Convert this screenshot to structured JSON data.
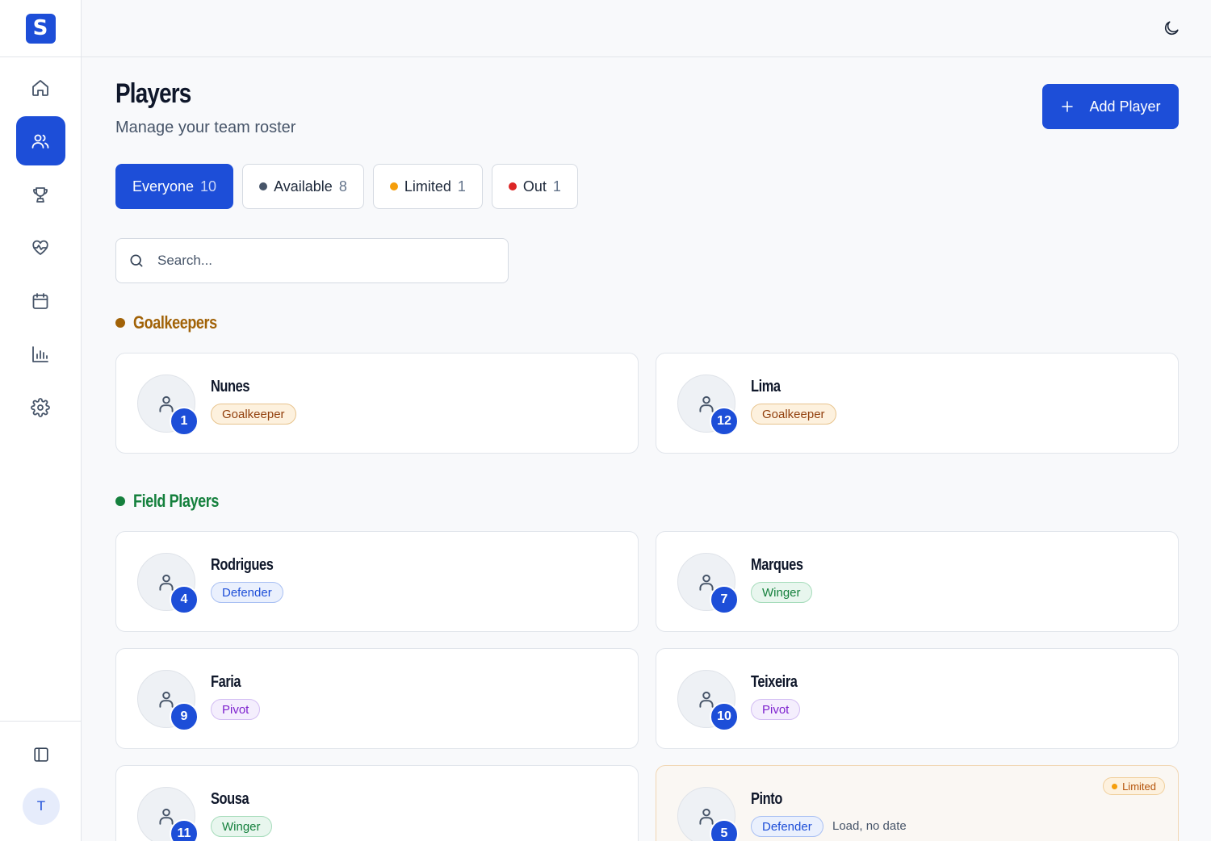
{
  "app": {
    "logo_letter": "S",
    "user_initial": "T",
    "accent": "#1d4ed8"
  },
  "sidebar": {
    "items": [
      {
        "name": "home-icon",
        "active": false
      },
      {
        "name": "users-icon",
        "active": true
      },
      {
        "name": "trophy-icon",
        "active": false
      },
      {
        "name": "heart-pulse-icon",
        "active": false
      },
      {
        "name": "calendar-icon",
        "active": false
      },
      {
        "name": "bar-chart-icon",
        "active": false
      },
      {
        "name": "gear-icon",
        "active": false
      }
    ],
    "collapse_icon": "sidebar-panel-icon",
    "theme_icon": "moon-icon"
  },
  "header": {
    "title": "Players",
    "subtitle": "Manage your team roster",
    "add_button_label": "Add Player"
  },
  "filters": [
    {
      "label": "Everyone",
      "count": "10",
      "dot_color": null,
      "active": true
    },
    {
      "label": "Available",
      "count": "8",
      "dot_color": "#475569",
      "active": false
    },
    {
      "label": "Limited",
      "count": "1",
      "dot_color": "#f59e0b",
      "active": false
    },
    {
      "label": "Out",
      "count": "1",
      "dot_color": "#dc2626",
      "active": false
    }
  ],
  "search": {
    "placeholder": "Search...",
    "value": ""
  },
  "sections": {
    "goalkeepers": {
      "title": "Goalkeepers",
      "color": "#a16207"
    },
    "field_players": {
      "title": "Field Players",
      "color": "#15803d"
    }
  },
  "players": {
    "nunes": {
      "name": "Nunes",
      "number": "1",
      "position": "Goalkeeper"
    },
    "lima": {
      "name": "Lima",
      "number": "12",
      "position": "Goalkeeper"
    },
    "rodrigues": {
      "name": "Rodrigues",
      "number": "4",
      "position": "Defender"
    },
    "marques": {
      "name": "Marques",
      "number": "7",
      "position": "Winger"
    },
    "faria": {
      "name": "Faria",
      "number": "9",
      "position": "Pivot"
    },
    "teixeira": {
      "name": "Teixeira",
      "number": "10",
      "position": "Pivot"
    },
    "sousa": {
      "name": "Sousa",
      "number": "11",
      "position": "Winger"
    },
    "pinto": {
      "name": "Pinto",
      "number": "5",
      "position": "Defender",
      "status": "Limited",
      "note": "Load, no date"
    }
  }
}
